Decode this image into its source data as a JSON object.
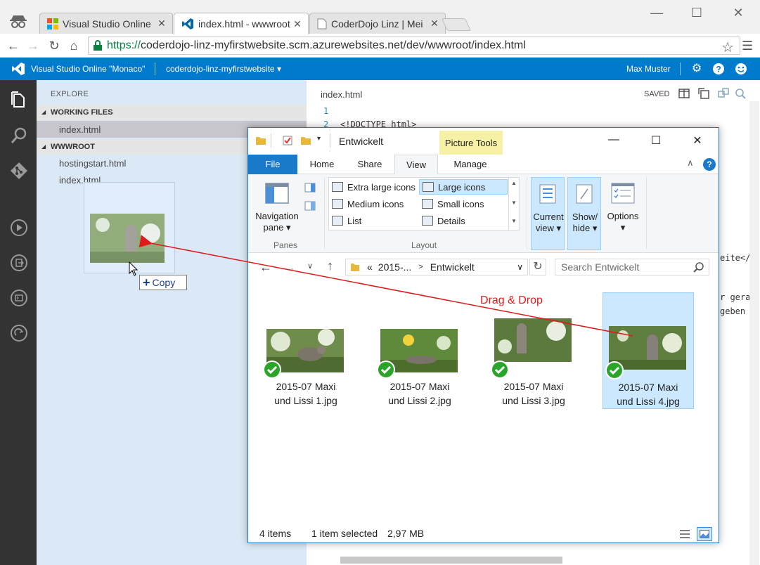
{
  "browser": {
    "tabs": [
      {
        "title": "Visual Studio Online"
      },
      {
        "title": "index.html - wwwroot"
      },
      {
        "title": "CoderDojo Linz | Mei"
      }
    ],
    "url_scheme": "https://",
    "url_rest": "coderdojo-linz-myfirstwebsite.scm.azurewebsites.net/dev/wwwroot/index.html"
  },
  "vs": {
    "title": "Visual Studio Online \"Monaco\"",
    "site": "coderdojo-linz-myfirstwebsite",
    "user": "Max Muster"
  },
  "explorer_pane": {
    "title": "EXPLORE",
    "working_files_label": "WORKING FILES",
    "working_files": [
      "index.html"
    ],
    "wwwroot_label": "WWWROOT",
    "wwwroot_files": [
      "hostingstart.html",
      "index.html"
    ]
  },
  "drag": {
    "copy_label": "Copy",
    "annotation": "Drag & Drop"
  },
  "editor": {
    "filename": "index.html",
    "saved_label": "SAVED",
    "lines": [
      {
        "num": "1",
        "text": ""
      },
      {
        "num": "2",
        "text": "<!DOCTYPE html>"
      }
    ],
    "fragments": {
      "eite": "eite</a",
      "gerade": "r gerad",
      "geben": "geben w"
    }
  },
  "win_explorer": {
    "title": "Entwickelt",
    "context_tab": "Picture Tools",
    "ribbon_tabs": {
      "file": "File",
      "home": "Home",
      "share": "Share",
      "view": "View",
      "manage": "Manage"
    },
    "panes": {
      "navigation_pane": "Navigation",
      "navigation_pane_2": "pane",
      "group": "Panes"
    },
    "layout": {
      "group": "Layout",
      "items": {
        "extra_large": "Extra large icons",
        "large": "Large icons",
        "medium": "Medium icons",
        "small": "Small icons",
        "list": "List",
        "details": "Details"
      }
    },
    "current_view": {
      "line1": "Current",
      "line2": "view"
    },
    "show_hide": {
      "line1": "Show/",
      "line2": "hide"
    },
    "options": "Options",
    "breadcrumb": {
      "prefix": "«",
      "parent": "2015-...",
      "current": "Entwickelt"
    },
    "search_placeholder": "Search Entwickelt",
    "files": [
      {
        "line1": "2015-07 Maxi",
        "line2": "und Lissi 1.jpg"
      },
      {
        "line1": "2015-07 Maxi",
        "line2": "und Lissi 2.jpg"
      },
      {
        "line1": "2015-07 Maxi",
        "line2": "und Lissi 3.jpg"
      },
      {
        "line1": "2015-07 Maxi",
        "line2": "und Lissi 4.jpg"
      }
    ],
    "status": {
      "items": "4 items",
      "selected": "1 item selected",
      "size": "2,97 MB"
    }
  },
  "colors": {
    "vs_blue": "#007acc",
    "explorer_accent": "#1979ca",
    "arrow_red": "#e01b1b",
    "selection": "#cce8ff"
  }
}
